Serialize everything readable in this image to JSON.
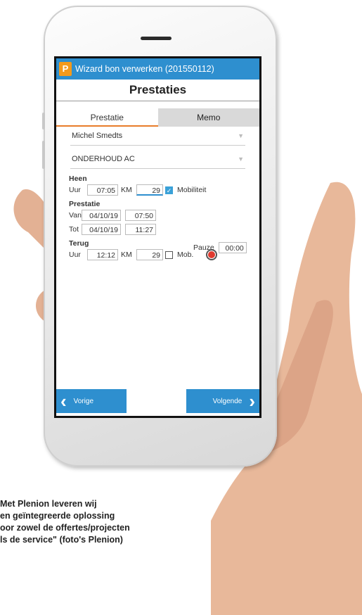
{
  "titlebar": {
    "logo": "P",
    "title": "Wizard bon verwerken (201550112)"
  },
  "page_title": "Prestaties",
  "tabs": [
    {
      "label": "Prestatie"
    },
    {
      "label": "Memo"
    }
  ],
  "selects": [
    {
      "value": "Michel Smedts"
    },
    {
      "value": "ONDERHOUD AC"
    }
  ],
  "heen": {
    "title": "Heen",
    "uur_label": "Uur",
    "uur": "07:05",
    "km_label": "KM",
    "km": "29",
    "mob_label": "Mobiliteit",
    "mob_checked": true
  },
  "prestatie": {
    "title": "Prestatie",
    "van_label": "Van",
    "van_date": "04/10/19",
    "van_time": "07:50",
    "tot_label": "Tot",
    "tot_date": "04/10/19",
    "tot_time": "11:27",
    "pauze_label": "Pauze",
    "pauze": "00:00"
  },
  "terug": {
    "title": "Terug",
    "uur_label": "Uur",
    "uur": "12:12",
    "km_label": "KM",
    "km": "29",
    "mob_label": "Mob.",
    "mob_checked": false
  },
  "nav": {
    "prev": "Vorige",
    "next": "Volgende"
  },
  "caption": [
    "Met Plenion leveren wij",
    "en geïntegreerde oplossing",
    "oor zowel de offertes/projecten",
    "ls de service\" (foto's Plenion)"
  ],
  "colors": {
    "accent": "#2e8fcf",
    "logo": "#f39a1c",
    "tab_underline": "#e87c2a"
  }
}
